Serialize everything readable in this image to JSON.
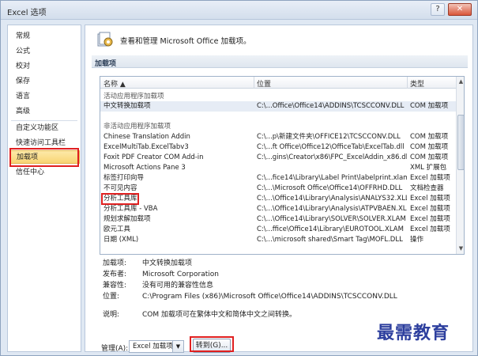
{
  "window": {
    "title": "Excel 选项",
    "help_glyph": "?",
    "close_glyph": "✕"
  },
  "nav": {
    "items": [
      "常规",
      "公式",
      "校对",
      "保存",
      "语言",
      "高级",
      "自定义功能区",
      "快速访问工具栏",
      "加载项",
      "信任中心"
    ],
    "active_index": 8
  },
  "header": {
    "text": "查看和管理 Microsoft Office 加载项。"
  },
  "section": {
    "title": "加载项"
  },
  "list": {
    "columns": {
      "name": "名称 ▲",
      "location": "位置",
      "type": "类型"
    },
    "groups": {
      "active": "活动应用程序加载项",
      "inactive": "非活动应用程序加载项"
    },
    "active_rows": [
      {
        "name": "中文转换加载项",
        "location": "C:\\...Office\\Office14\\ADDINS\\TCSCCONV.DLL",
        "type": "COM 加载项"
      }
    ],
    "inactive_rows": [
      {
        "name": "Chinese Translation Addin",
        "location": "C:\\...p\\新建文件夹\\OFFICE12\\TCSCCONV.DLL",
        "type": "COM 加载项"
      },
      {
        "name": "ExcelMultiTab.ExcelTabv3",
        "location": "C:\\...ft Office\\Office12\\OfficeTab\\ExcelTab.dll",
        "type": "COM 加载项"
      },
      {
        "name": "Foxit PDF Creator COM Add-in",
        "location": "C:\\...gins\\Creator\\x86\\FPC_ExcelAddin_x86.dll",
        "type": "COM 加载项"
      },
      {
        "name": "Microsoft Actions Pane 3",
        "location": "",
        "type": "XML 扩展包"
      },
      {
        "name": "标签打印向导",
        "location": "C:\\...fice14\\Library\\Label Print\\labelprint.xlam",
        "type": "Excel 加载项"
      },
      {
        "name": "不可见内容",
        "location": "C:\\...\\Microsoft Office\\Office14\\OFFRHD.DLL",
        "type": "文档检查器"
      },
      {
        "name": "分析工具库",
        "location": "C:\\...\\Office14\\Library\\Analysis\\ANALYS32.XLL",
        "type": "Excel 加载项"
      },
      {
        "name": "分析工具库 - VBA",
        "location": "C:\\...\\Office14\\Library\\Analysis\\ATPVBAEN.XLAM",
        "type": "Excel 加载项"
      },
      {
        "name": "规划求解加载项",
        "location": "C:\\...\\Office14\\Library\\SOLVER\\SOLVER.XLAM",
        "type": "Excel 加载项"
      },
      {
        "name": "欧元工具",
        "location": "C:\\...ffice\\Office14\\Library\\EUROTOOL.XLAM",
        "type": "Excel 加载项"
      },
      {
        "name": "日期 (XML)",
        "location": "C:\\...\\microsoft shared\\Smart Tag\\MOFL.DLL",
        "type": "操作"
      }
    ]
  },
  "details": {
    "addin_label": "加载项:",
    "addin_value": "中文转换加载项",
    "publisher_label": "发布者:",
    "publisher_value": "Microsoft Corporation",
    "compat_label": "兼容性:",
    "compat_value": "没有可用的兼容性信息",
    "location_label": "位置:",
    "location_value": "C:\\Program Files (x86)\\Microsoft Office\\Office14\\ADDINS\\TCSCCONV.DLL",
    "desc_label": "说明:",
    "desc_value": "COM 加载项可在繁体中文和简体中文之间转换。"
  },
  "manage": {
    "label": "管理(A):",
    "selected": "Excel 加载项",
    "go_label": "转到(G)..."
  },
  "watermark": "最需教育",
  "colors": {
    "highlight": "#e02020",
    "active_nav": "#f8d574"
  }
}
